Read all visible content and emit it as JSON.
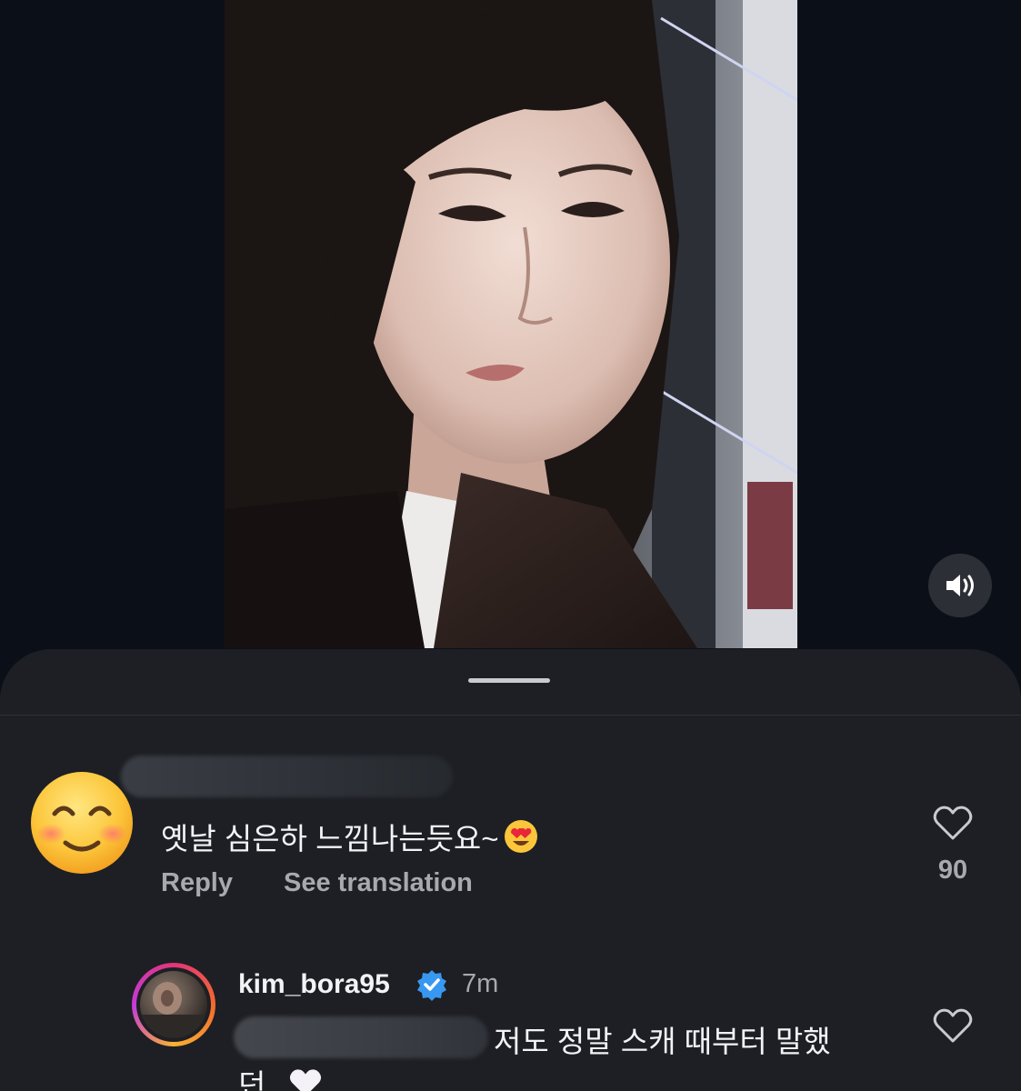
{
  "video": {
    "sound_icon": "speaker-icon"
  },
  "comment": {
    "avatar_icon": "smiling-face-emoji",
    "text": "옛날 심은하 느낌나는듯요~",
    "text_emoji": "heart-eyes-emoji",
    "reply_label": "Reply",
    "translate_label": "See translation",
    "like_icon": "heart-outline-icon",
    "like_count": "90"
  },
  "reply": {
    "username": "kim_bora95",
    "verified_icon": "verified-badge-icon",
    "time": "7m",
    "text_line1": "저도 정말 스캐 때부터 말했",
    "text_line2": "던,,",
    "text_emoji": "white-heart-emoji",
    "like_icon": "heart-outline-icon"
  },
  "colors": {
    "background": "#0b1018",
    "sheet": "#1d1f24",
    "primary_text": "#f2f3f5",
    "secondary_text": "#a6a9ae",
    "verified_blue": "#3897f0"
  }
}
